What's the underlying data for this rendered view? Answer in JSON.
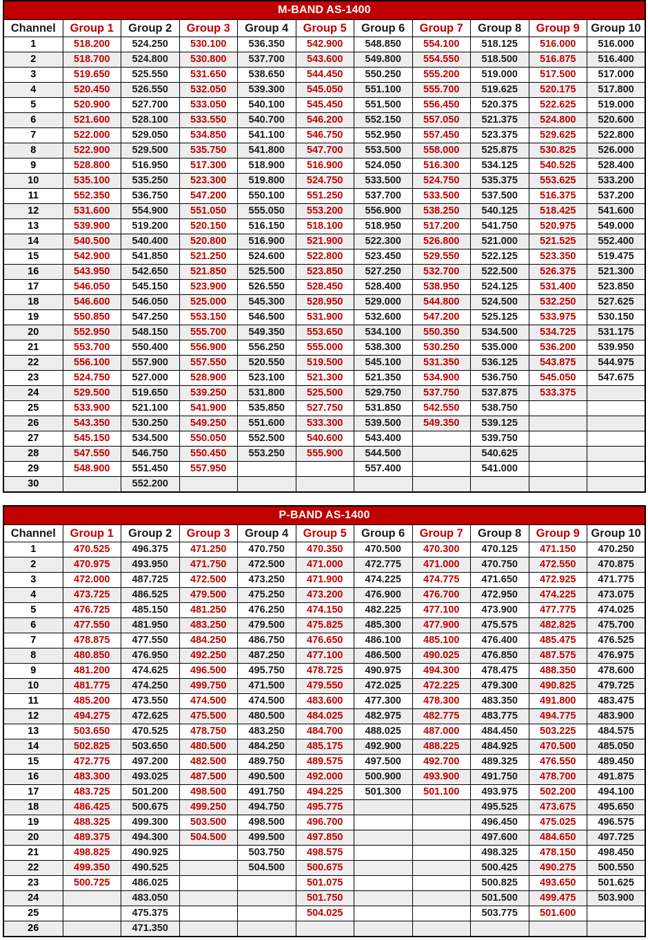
{
  "page": {
    "columns": [
      "Channel",
      "Group 1",
      "Group 2",
      "Group 3",
      "Group 4",
      "Group 5",
      "Group 6",
      "Group 7",
      "Group 8",
      "Group 9",
      "Group 10"
    ],
    "colors": {
      "title_bg": "#c00000",
      "title_text": "#ffffff",
      "odd_group_text": "#c00000",
      "even_group_text": "#1a1a1a",
      "alt_row_bg": "#ededed",
      "row_bg": "#ffffff"
    }
  },
  "tables": [
    {
      "title": "M-BAND AS-1400",
      "headers": [
        "Channel",
        "Group 1",
        "Group 2",
        "Group 3",
        "Group 4",
        "Group 5",
        "Group 6",
        "Group 7",
        "Group 8",
        "Group 9",
        "Group 10"
      ],
      "rows": [
        [
          "1",
          "518.200",
          "524.250",
          "530.100",
          "536.350",
          "542.900",
          "548.850",
          "554.100",
          "518.125",
          "516.000",
          "516.000"
        ],
        [
          "2",
          "518.700",
          "524.800",
          "530.800",
          "537.700",
          "543.600",
          "549.800",
          "554.550",
          "518.500",
          "516.875",
          "516.400"
        ],
        [
          "3",
          "519.650",
          "525.550",
          "531.650",
          "538.650",
          "544.450",
          "550.250",
          "555.200",
          "519.000",
          "517.500",
          "517.000"
        ],
        [
          "4",
          "520.450",
          "526.550",
          "532.050",
          "539.300",
          "545.050",
          "551.100",
          "555.700",
          "519.625",
          "520.175",
          "517.800"
        ],
        [
          "5",
          "520.900",
          "527.700",
          "533.050",
          "540.100",
          "545.450",
          "551.500",
          "556.450",
          "520.375",
          "522.625",
          "519.000"
        ],
        [
          "6",
          "521.600",
          "528.100",
          "533.550",
          "540.700",
          "546.200",
          "552.150",
          "557.050",
          "521.375",
          "524.800",
          "520.600"
        ],
        [
          "7",
          "522.000",
          "529.050",
          "534.850",
          "541.100",
          "546.750",
          "552.950",
          "557.450",
          "523.375",
          "529.625",
          "522.800"
        ],
        [
          "8",
          "522.900",
          "529.500",
          "535.750",
          "541.800",
          "547.700",
          "553.500",
          "558.000",
          "525.875",
          "530.825",
          "526.000"
        ],
        [
          "9",
          "528.800",
          "516.950",
          "517.300",
          "518.900",
          "516.900",
          "524.050",
          "516.300",
          "534.125",
          "540.525",
          "528.400"
        ],
        [
          "10",
          "535.100",
          "535.250",
          "523.300",
          "519.800",
          "524.750",
          "533.500",
          "524.750",
          "535.375",
          "553.625",
          "533.200"
        ],
        [
          "11",
          "552.350",
          "536.750",
          "547.200",
          "550.100",
          "551.250",
          "537.700",
          "533.500",
          "537.500",
          "516.375",
          "537.200"
        ],
        [
          "12",
          "531.600",
          "554.900",
          "551.050",
          "555.050",
          "553.200",
          "556.900",
          "538.250",
          "540.125",
          "518.425",
          "541.600"
        ],
        [
          "13",
          "539.900",
          "519.200",
          "520.150",
          "516.150",
          "518.100",
          "518.950",
          "517.200",
          "541.750",
          "520.975",
          "549.000"
        ],
        [
          "14",
          "540.500",
          "540.400",
          "520.800",
          "516.900",
          "521.900",
          "522.300",
          "526.800",
          "521.000",
          "521.525",
          "552.400"
        ],
        [
          "15",
          "542.900",
          "541.850",
          "521.250",
          "524.600",
          "522.800",
          "523.450",
          "529.550",
          "522.125",
          "523.350",
          "519.475"
        ],
        [
          "16",
          "543.950",
          "542.650",
          "521.850",
          "525.500",
          "523.850",
          "527.250",
          "532.700",
          "522.500",
          "526.375",
          "521.300"
        ],
        [
          "17",
          "546.050",
          "545.150",
          "523.900",
          "526.550",
          "528.450",
          "528.400",
          "538.950",
          "524.125",
          "531.400",
          "523.850"
        ],
        [
          "18",
          "546.600",
          "546.050",
          "525.000",
          "545.300",
          "528.950",
          "529.000",
          "544.800",
          "524.500",
          "532.250",
          "527.625"
        ],
        [
          "19",
          "550.850",
          "547.250",
          "553.150",
          "546.500",
          "531.900",
          "532.600",
          "547.200",
          "525.125",
          "533.975",
          "530.150"
        ],
        [
          "20",
          "552.950",
          "548.150",
          "555.700",
          "549.350",
          "553.650",
          "534.100",
          "550.350",
          "534.500",
          "534.725",
          "531.175"
        ],
        [
          "21",
          "553.700",
          "550.400",
          "556.900",
          "556.250",
          "555.000",
          "538.300",
          "530.250",
          "535.000",
          "536.200",
          "539.950"
        ],
        [
          "22",
          "556.100",
          "557.900",
          "557.550",
          "520.550",
          "519.500",
          "545.100",
          "531.350",
          "536.125",
          "543.875",
          "544.975"
        ],
        [
          "23",
          "524.750",
          "527.000",
          "528.900",
          "523.100",
          "521.300",
          "521.350",
          "534.900",
          "536.750",
          "545.050",
          "547.675"
        ],
        [
          "24",
          "529.500",
          "519.650",
          "539.250",
          "531.800",
          "525.500",
          "529.750",
          "537.750",
          "537.875",
          "533.375",
          ""
        ],
        [
          "25",
          "533.900",
          "521.100",
          "541.900",
          "535.850",
          "527.750",
          "531.850",
          "542.550",
          "538.750",
          "",
          ""
        ],
        [
          "26",
          "543.350",
          "530.250",
          "549.250",
          "551.600",
          "533.300",
          "539.500",
          "549.350",
          "539.125",
          "",
          ""
        ],
        [
          "27",
          "545.150",
          "534.500",
          "550.050",
          "552.500",
          "540.600",
          "543.400",
          "",
          "539.750",
          "",
          ""
        ],
        [
          "28",
          "547.550",
          "546.750",
          "550.450",
          "553.250",
          "555.900",
          "544.500",
          "",
          "540.625",
          "",
          ""
        ],
        [
          "29",
          "548.900",
          "551.450",
          "557.950",
          "",
          "",
          "557.400",
          "",
          "541.000",
          "",
          ""
        ],
        [
          "30",
          "",
          "552.200",
          "",
          "",
          "",
          "",
          "",
          "",
          "",
          ""
        ]
      ]
    },
    {
      "title": "P-BAND AS-1400",
      "headers": [
        "Channel",
        "Group 1",
        "Group 2",
        "Group 3",
        "Group 4",
        "Group 5",
        "Group 6",
        "Group 7",
        "Group 8",
        "Group 9",
        "Group 10"
      ],
      "rows": [
        [
          "1",
          "470.525",
          "496.375",
          "471.250",
          "470.750",
          "470.350",
          "470.500",
          "470.300",
          "470.125",
          "471.150",
          "470.250"
        ],
        [
          "2",
          "470.975",
          "493.950",
          "471.750",
          "472.500",
          "471.000",
          "472.775",
          "471.000",
          "470.750",
          "472.550",
          "470.875"
        ],
        [
          "3",
          "472.000",
          "487.725",
          "472.500",
          "473.250",
          "471.900",
          "474.225",
          "474.775",
          "471.650",
          "472.925",
          "471.775"
        ],
        [
          "4",
          "473.725",
          "486.525",
          "479.500",
          "475.250",
          "473.200",
          "476.900",
          "476.700",
          "472.950",
          "474.225",
          "473.075"
        ],
        [
          "5",
          "476.725",
          "485.150",
          "481.250",
          "476.250",
          "474.150",
          "482.225",
          "477.100",
          "473.900",
          "477.775",
          "474.025"
        ],
        [
          "6",
          "477.550",
          "481.950",
          "483.250",
          "479.500",
          "475.825",
          "485.300",
          "477.900",
          "475.575",
          "482.825",
          "475.700"
        ],
        [
          "7",
          "478.875",
          "477.550",
          "484.250",
          "486.750",
          "476.650",
          "486.100",
          "485.100",
          "476.400",
          "485.475",
          "476.525"
        ],
        [
          "8",
          "480.850",
          "476.950",
          "492.250",
          "487.250",
          "477.100",
          "486.500",
          "490.025",
          "476.850",
          "487.575",
          "476.975"
        ],
        [
          "9",
          "481.200",
          "474.625",
          "496.500",
          "495.750",
          "478.725",
          "490.975",
          "494.300",
          "478.475",
          "488.350",
          "478.600"
        ],
        [
          "10",
          "481.775",
          "474.250",
          "499.750",
          "471.500",
          "479.550",
          "472.025",
          "472.225",
          "479.300",
          "490.825",
          "479.725"
        ],
        [
          "11",
          "485.200",
          "473.550",
          "474.500",
          "474.500",
          "483.600",
          "477.300",
          "478.300",
          "483.350",
          "491.800",
          "483.475"
        ],
        [
          "12",
          "494.275",
          "472.625",
          "475.500",
          "480.500",
          "484.025",
          "482.975",
          "482.775",
          "483.775",
          "494.775",
          "483.900"
        ],
        [
          "13",
          "503.650",
          "470.525",
          "478.750",
          "483.250",
          "484.700",
          "488.025",
          "487.000",
          "484.450",
          "503.225",
          "484.575"
        ],
        [
          "14",
          "502.825",
          "503.650",
          "480.500",
          "484.250",
          "485.175",
          "492.900",
          "488.225",
          "484.925",
          "470.500",
          "485.050"
        ],
        [
          "15",
          "472.775",
          "497.200",
          "482.500",
          "489.750",
          "489.575",
          "497.500",
          "492.700",
          "489.325",
          "476.550",
          "489.450"
        ],
        [
          "16",
          "483.300",
          "493.025",
          "487.500",
          "490.500",
          "492.000",
          "500.900",
          "493.900",
          "491.750",
          "478.700",
          "491.875"
        ],
        [
          "17",
          "483.725",
          "501.200",
          "498.500",
          "491.750",
          "494.225",
          "501.300",
          "501.100",
          "493.975",
          "502.200",
          "494.100"
        ],
        [
          "18",
          "486.425",
          "500.675",
          "499.250",
          "494.750",
          "495.775",
          "",
          "",
          "495.525",
          "473.675",
          "495.650"
        ],
        [
          "19",
          "488.325",
          "499.300",
          "503.500",
          "498.500",
          "496.700",
          "",
          "",
          "496.450",
          "475.025",
          "496.575"
        ],
        [
          "20",
          "489.375",
          "494.300",
          "504.500",
          "499.500",
          "497.850",
          "",
          "",
          "497.600",
          "484.650",
          "497.725"
        ],
        [
          "21",
          "498.825",
          "490.925",
          "",
          "503.750",
          "498.575",
          "",
          "",
          "498.325",
          "478.150",
          "498.450"
        ],
        [
          "22",
          "499.350",
          "490.525",
          "",
          "504.500",
          "500.675",
          "",
          "",
          "500.425",
          "490.275",
          "500.550"
        ],
        [
          "23",
          "500.725",
          "486.025",
          "",
          "",
          "501.075",
          "",
          "",
          "500.825",
          "493.650",
          "501.625"
        ],
        [
          "24",
          "",
          "483.050",
          "",
          "",
          "501.750",
          "",
          "",
          "501.500",
          "499.475",
          "503.900"
        ],
        [
          "25",
          "",
          "475.375",
          "",
          "",
          "504.025",
          "",
          "",
          "503.775",
          "501.600",
          ""
        ],
        [
          "26",
          "",
          "471.350",
          "",
          "",
          "",
          "",
          "",
          "",
          "",
          ""
        ]
      ]
    }
  ]
}
